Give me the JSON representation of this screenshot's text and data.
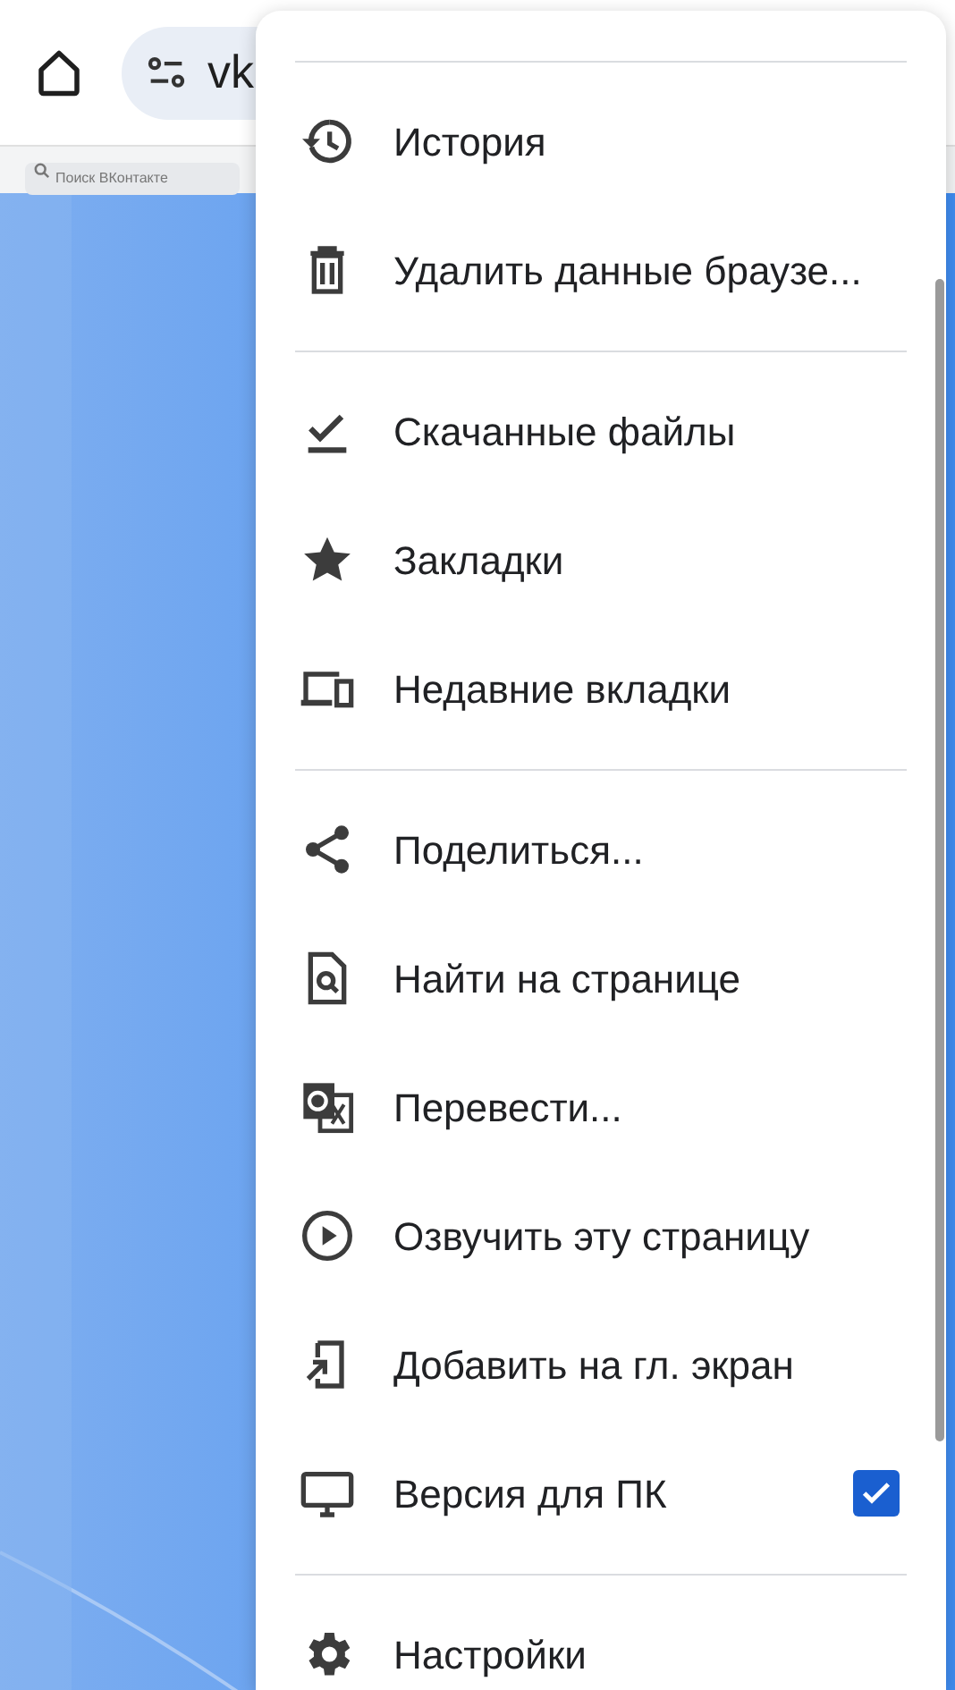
{
  "toolbar": {
    "url": "vk"
  },
  "page": {
    "search_placeholder": "Поиск ВКонтакте"
  },
  "menu": {
    "sections": [
      [
        {
          "label": "История"
        },
        {
          "label": "Удалить данные браузе..."
        }
      ],
      [
        {
          "label": "Скачанные файлы"
        },
        {
          "label": "Закладки"
        },
        {
          "label": "Недавние вкладки"
        }
      ],
      [
        {
          "label": "Поделиться..."
        },
        {
          "label": "Найти на странице"
        },
        {
          "label": "Перевести..."
        },
        {
          "label": "Озвучить эту страницу"
        },
        {
          "label": "Добавить на гл. экран"
        },
        {
          "label": "Версия для ПК",
          "kind": "checkbox",
          "checked": true
        }
      ],
      [
        {
          "label": "Настройки"
        }
      ]
    ]
  }
}
